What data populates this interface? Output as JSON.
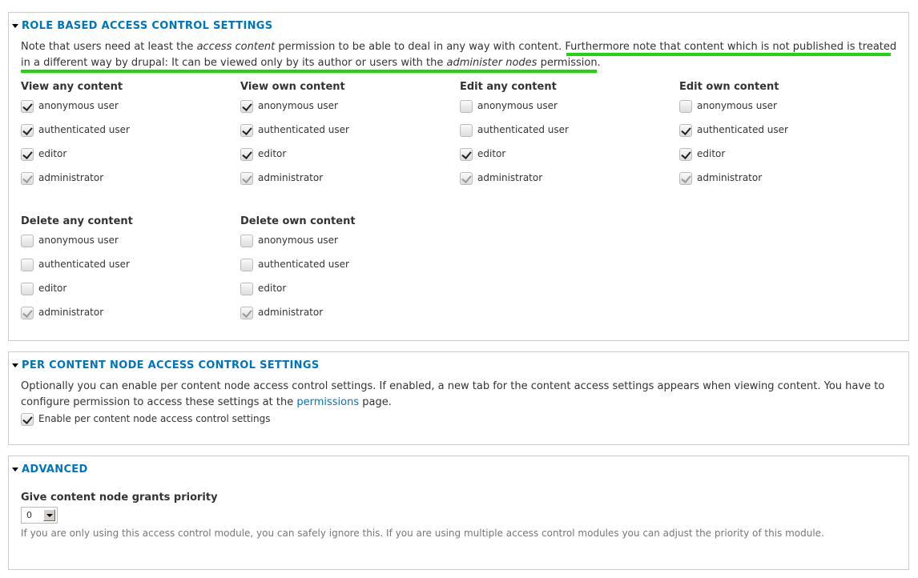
{
  "role_section": {
    "title": "ROLE BASED ACCESS CONTROL SETTINGS",
    "desc_parts": [
      "Note that users need at least the ",
      "access content",
      " permission to be able to deal in any way with content. Furthermore note that content which is not published is treated in a different way by drupal: It can be viewed only by its author or users with the ",
      "administer nodes",
      " permission."
    ],
    "groups_row1": [
      {
        "title": "View any content",
        "items": [
          {
            "label": "anonymous user",
            "checked": true
          },
          {
            "label": "authenticated user",
            "checked": true
          },
          {
            "label": "editor",
            "checked": true
          },
          {
            "label": "administrator",
            "checked": true,
            "disabled": true
          }
        ]
      },
      {
        "title": "View own content",
        "items": [
          {
            "label": "anonymous user",
            "checked": true
          },
          {
            "label": "authenticated user",
            "checked": true
          },
          {
            "label": "editor",
            "checked": true
          },
          {
            "label": "administrator",
            "checked": true,
            "disabled": true
          }
        ]
      },
      {
        "title": "Edit any content",
        "items": [
          {
            "label": "anonymous user",
            "checked": false
          },
          {
            "label": "authenticated user",
            "checked": false
          },
          {
            "label": "editor",
            "checked": true
          },
          {
            "label": "administrator",
            "checked": true,
            "disabled": true
          }
        ]
      },
      {
        "title": "Edit own content",
        "items": [
          {
            "label": "anonymous user",
            "checked": false
          },
          {
            "label": "authenticated user",
            "checked": true
          },
          {
            "label": "editor",
            "checked": true
          },
          {
            "label": "administrator",
            "checked": true,
            "disabled": true
          }
        ]
      }
    ],
    "groups_row2": [
      {
        "title": "Delete any content",
        "items": [
          {
            "label": "anonymous user",
            "checked": false
          },
          {
            "label": "authenticated user",
            "checked": false
          },
          {
            "label": "editor",
            "checked": false
          },
          {
            "label": "administrator",
            "checked": true,
            "disabled": true
          }
        ]
      },
      {
        "title": "Delete own content",
        "items": [
          {
            "label": "anonymous user",
            "checked": false
          },
          {
            "label": "authenticated user",
            "checked": false
          },
          {
            "label": "editor",
            "checked": false
          },
          {
            "label": "administrator",
            "checked": true,
            "disabled": true
          }
        ]
      }
    ]
  },
  "per_node_section": {
    "title": "PER CONTENT NODE ACCESS CONTROL SETTINGS",
    "desc_before": "Optionally you can enable per content node access control settings. If enabled, a new tab for the content access settings appears when viewing content. You have to configure permission to access these settings at the ",
    "link": "permissions",
    "desc_after": " page.",
    "checkbox": {
      "label": "Enable per content node access control settings",
      "checked": true
    }
  },
  "advanced_section": {
    "title": "ADVANCED",
    "field_label": "Give content node grants priority",
    "select_value": "0",
    "hint": "If you are only using this access control module, you can safely ignore this. If you are using multiple access control modules you can adjust the priority of this module."
  },
  "annotation_color": "#1ed70a"
}
